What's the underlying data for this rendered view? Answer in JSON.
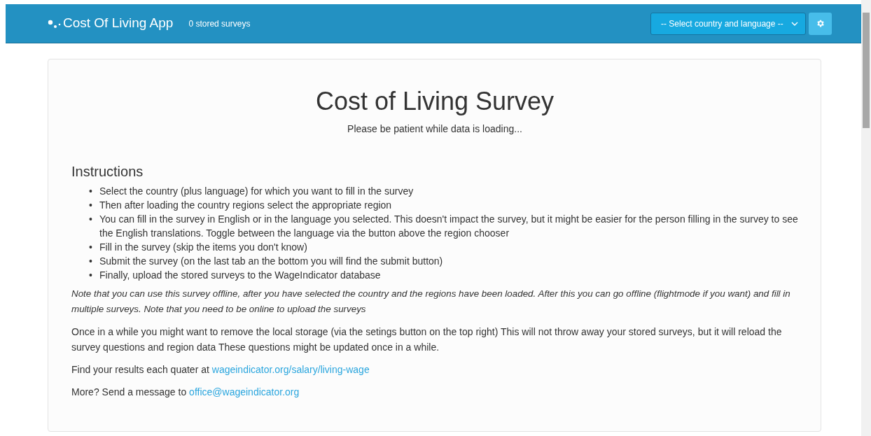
{
  "navbar": {
    "brand": "Cost Of Living App",
    "stored_count": "0 stored surveys",
    "country_select": {
      "value": "-- Select country and language --"
    }
  },
  "main": {
    "title": "Cost of Living Survey",
    "loading": "Please be patient while data is loading...",
    "instructions_heading": "Instructions",
    "instructions": [
      {
        "bullet": "•",
        "text": "Select the country (plus language) for which you want to fill in the survey"
      },
      {
        "bullet": "•",
        "text": "Then after loading the country regions select the appropriate region"
      },
      {
        "bullet": "•",
        "text": "You can fill in the survey in English or in the language you selected. This doesn't impact the survey, but it might be easier for the person filling in the survey to see the English translations. Toggle between the language via the button above the region chooser"
      },
      {
        "bullet": "•",
        "text": "Fill in the survey (skip the items you don't know)"
      },
      {
        "bullet": "•",
        "text": "Submit the survey (on the last tab an the bottom you will find the submit button)"
      },
      {
        "bullet": "•",
        "text": "Finally, upload the stored surveys to the WageIndicator database"
      }
    ],
    "paragraphs": [
      {
        "kind": "note",
        "text": "Note that you can use this survey offline, after you have selected the country and the regions have been loaded. After this you can go offline (flightmode if you want) and fill in multiple surveys. Note that you need to be online to upload the surveys"
      },
      {
        "kind": "plain",
        "text": "Once in a while you might want to remove the local storage (via the setings button on the top right) This will not throw away your stored surveys, but it will reload the survey questions and region data These questions might be updated once in a while."
      },
      {
        "kind": "link",
        "text": "Find your results each quater at ",
        "link": "wageindicator.org/salary/living-wage"
      },
      {
        "kind": "link",
        "text": "More? Send a message to ",
        "link": "office@wageindicator.org"
      }
    ]
  }
}
